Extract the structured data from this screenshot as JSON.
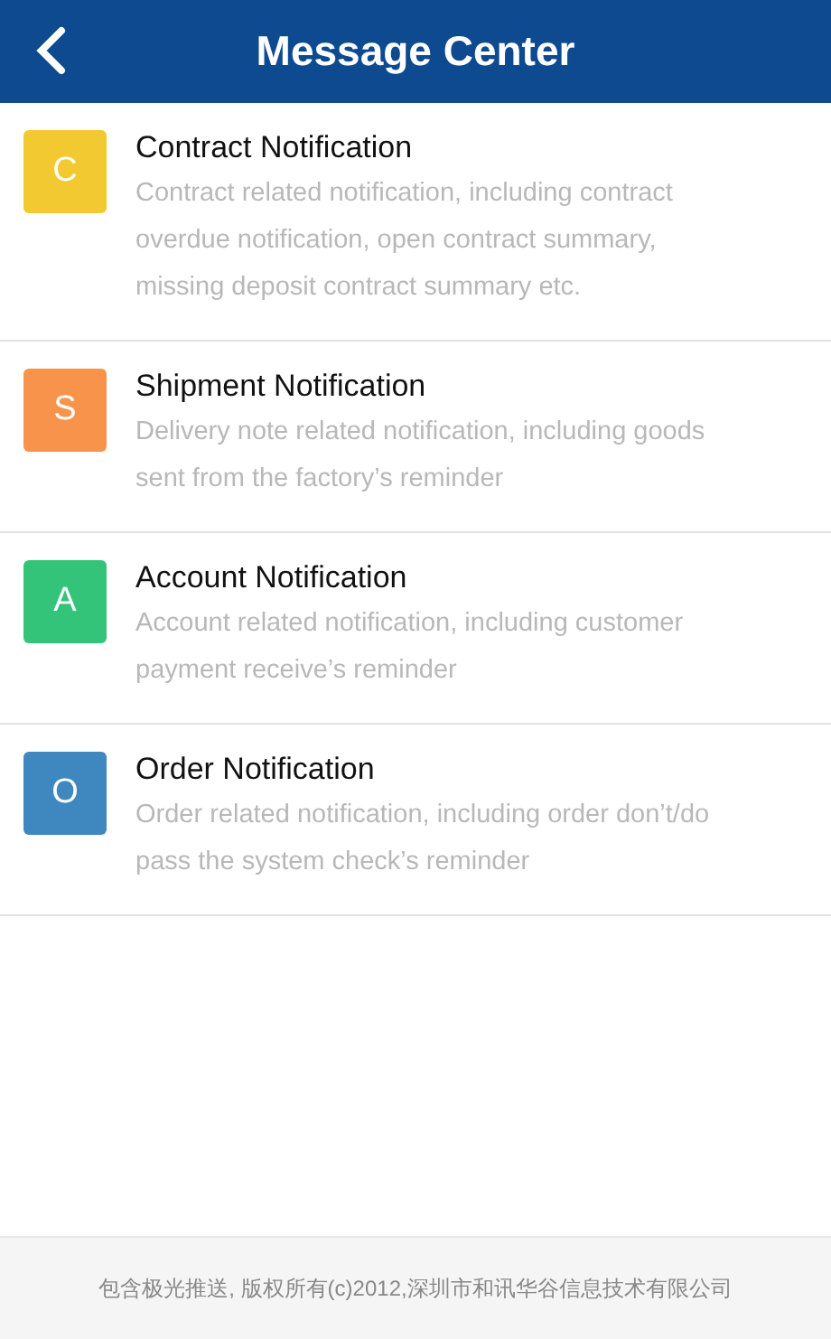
{
  "header": {
    "title": "Message Center"
  },
  "notifications": [
    {
      "letter": "C",
      "color": "#f2c930",
      "title": "Contract Notification",
      "description": "Contract related notification, including contract overdue notification, open contract summary, missing deposit contract summary etc."
    },
    {
      "letter": "S",
      "color": "#f7934a",
      "title": "Shipment Notification",
      "description": "Delivery note related notification, including goods sent from the factory’s reminder"
    },
    {
      "letter": "A",
      "color": "#33c47a",
      "title": "Account Notification",
      "description": "Account related notification, including customer payment receive’s reminder"
    },
    {
      "letter": "O",
      "color": "#3f88bf",
      "title": "Order Notification",
      "description": "Order related notification, including order don’t/do pass the system check’s reminder"
    }
  ],
  "footer": "包含极光推送, 版权所有(c)2012,深圳市和讯华谷信息技术有限公司"
}
